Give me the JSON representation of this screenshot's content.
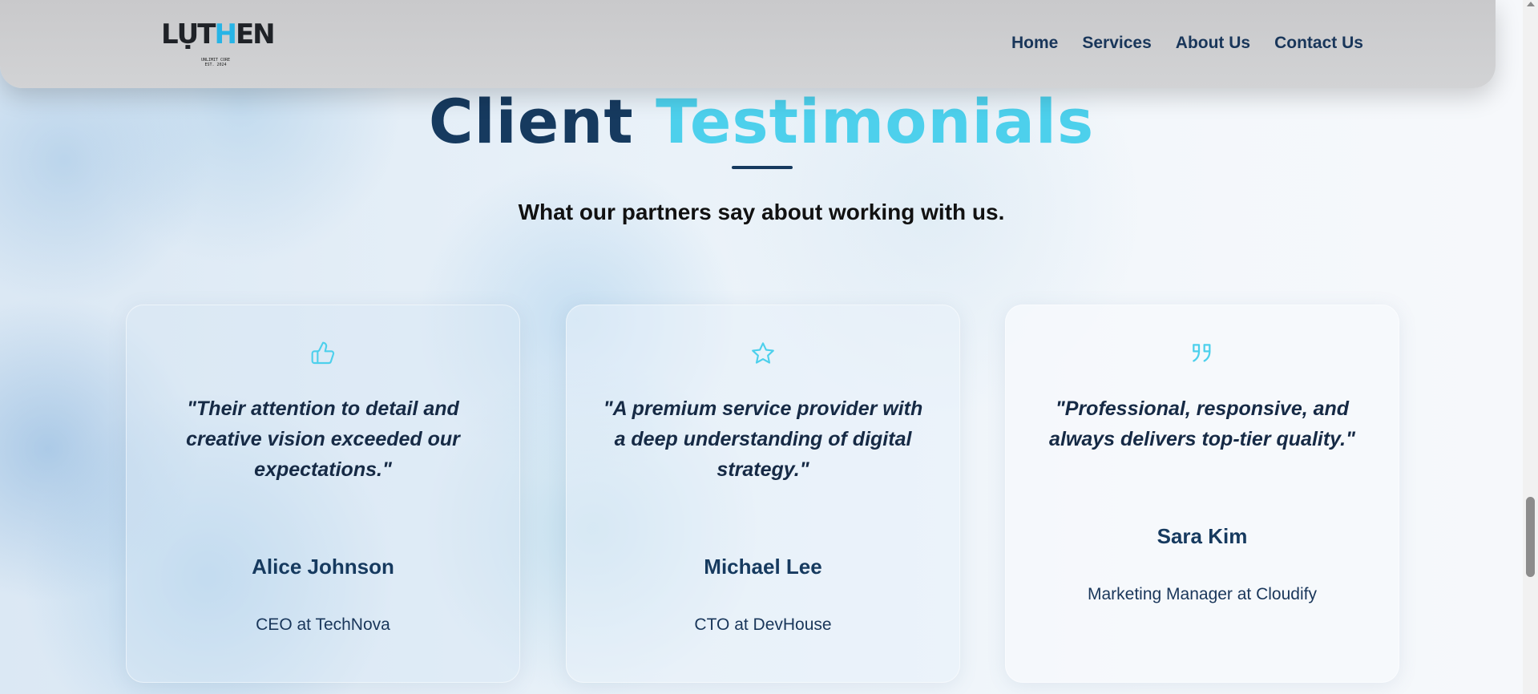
{
  "header": {
    "logo": {
      "word_part1": "LỤT",
      "word_highlight": "H",
      "word_part2": "EN",
      "small_line1": "UNLIMIT CORE",
      "small_line2": "EST. 2024"
    },
    "nav": [
      "Home",
      "Services",
      "About Us",
      "Contact Us"
    ]
  },
  "testimonials": {
    "title_part1": "Client",
    "title_part2": "Testimonials",
    "subtitle": "What our partners say about working with us.",
    "cards": [
      {
        "icon": "thumbs-up-icon",
        "quote": "\"Their attention to detail and creative vision exceeded our expectations.\"",
        "name": "Alice Johnson",
        "role": "CEO at TechNova"
      },
      {
        "icon": "star-icon",
        "quote": "\"A premium service provider with a deep understanding of digital strategy.\"",
        "name": "Michael Lee",
        "role": "CTO at DevHouse"
      },
      {
        "icon": "quote-icon",
        "quote": "\"Professional, responsive, and always delivers top-tier quality.\"",
        "name": "Sara Kim",
        "role": "Marketing Manager at Cloudify"
      }
    ]
  },
  "colors": {
    "navy": "#163a5f",
    "accent": "#4dd0ec",
    "header_bg": "#cfd0d2"
  }
}
